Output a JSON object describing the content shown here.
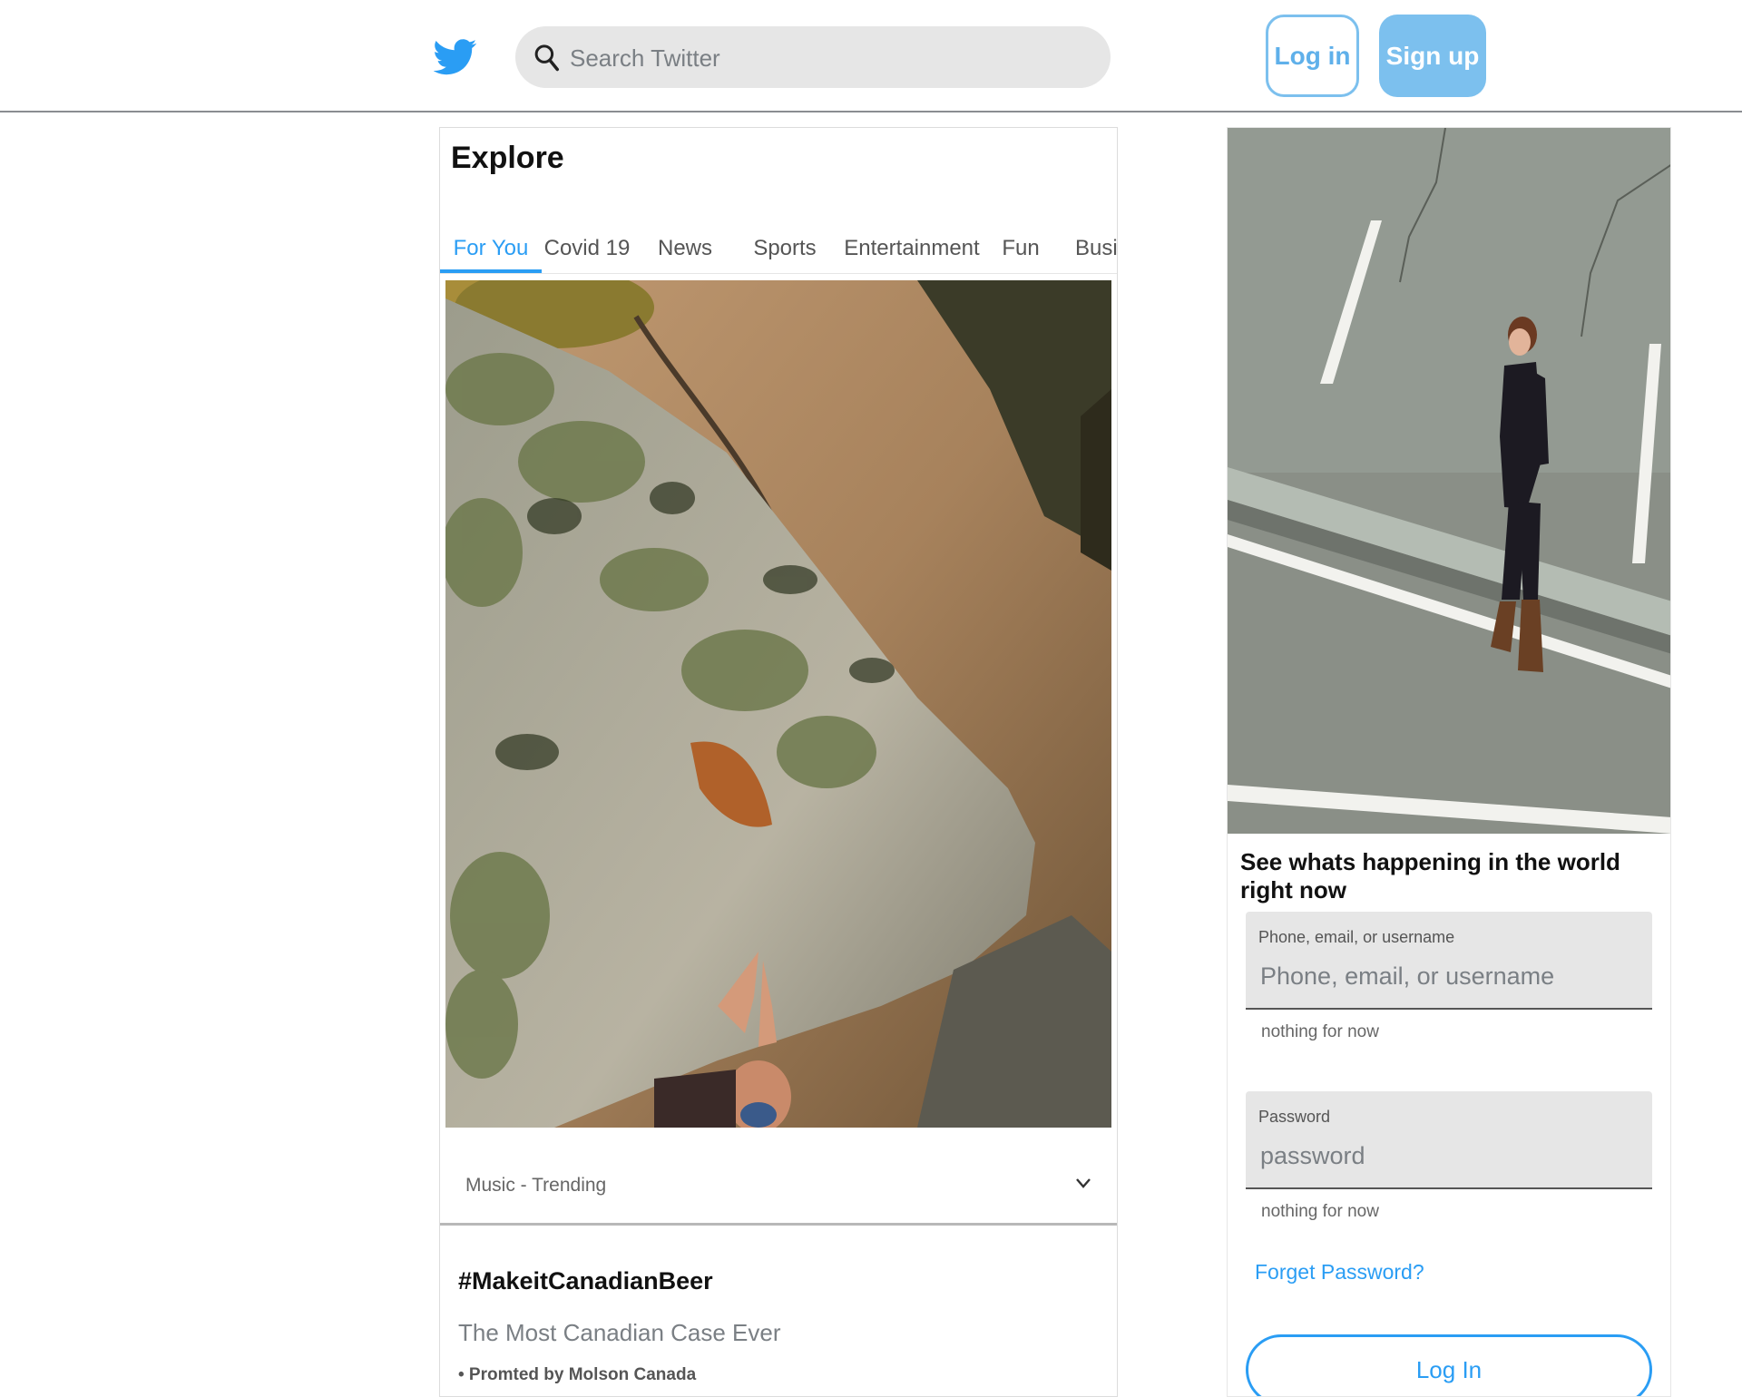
{
  "header": {
    "logo_icon": "twitter-bird-icon",
    "search_icon": "search-icon",
    "search_placeholder": "Search Twitter",
    "login_label": "Log in",
    "signup_label": "Sign up"
  },
  "explore": {
    "title": "Explore",
    "tabs": [
      {
        "label": "For You",
        "active": true
      },
      {
        "label": "Covid 19",
        "active": false
      },
      {
        "label": "News",
        "active": false
      },
      {
        "label": "Sports",
        "active": false
      },
      {
        "label": "Entertainment",
        "active": false
      },
      {
        "label": "Fun",
        "active": false
      },
      {
        "label": "Busi",
        "active": false
      }
    ],
    "trend_label": "Music - Trending",
    "promoted": {
      "hashtag": "#MakeitCanadianBeer",
      "description": "The Most Canadian Case Ever",
      "by": "• Promted by Molson Canada"
    }
  },
  "sidebar": {
    "heading": "See whats happening in the world right now",
    "username_label": "Phone, email, or username",
    "username_placeholder": "Phone, email, or username",
    "username_helper": "nothing for now",
    "password_label": "Password",
    "password_placeholder": "password",
    "password_helper": "nothing for now",
    "forget_label": "Forget Password?",
    "login_label": "Log In"
  },
  "colors": {
    "accent": "#2a9df4",
    "accent_light": "#7cc0ee",
    "field_bg": "#e6e6e6"
  }
}
